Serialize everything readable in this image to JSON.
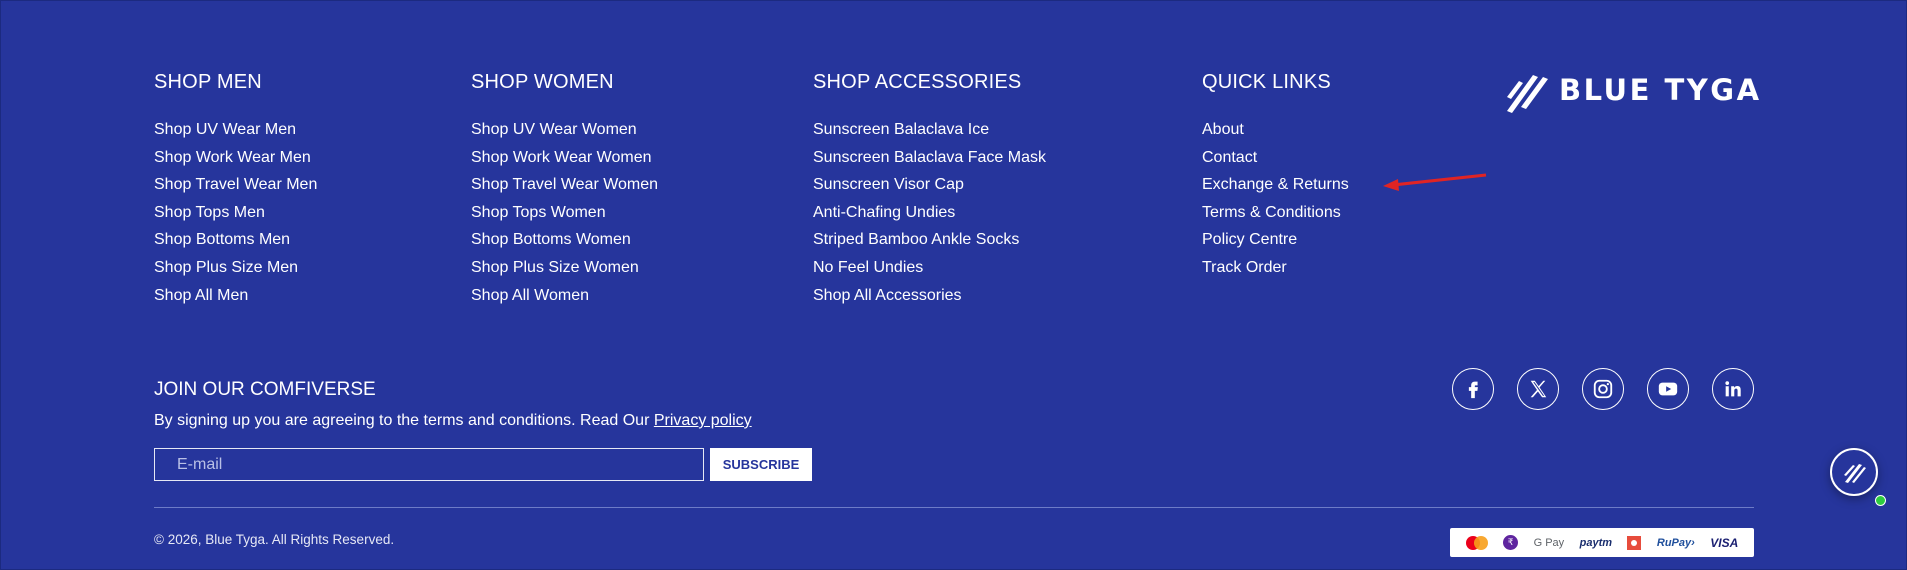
{
  "columns": {
    "men": {
      "title": "SHOP MEN",
      "links": [
        "Shop UV Wear Men",
        "Shop Work Wear Men",
        "Shop Travel Wear Men",
        "Shop Tops Men",
        "Shop Bottoms Men",
        "Shop Plus Size Men",
        "Shop All Men"
      ]
    },
    "women": {
      "title": "SHOP WOMEN",
      "links": [
        "Shop UV Wear Women",
        "Shop Work Wear Women",
        "Shop Travel Wear Women",
        "Shop Tops Women",
        "Shop Bottoms Women",
        "Shop Plus Size Women",
        "Shop All Women"
      ]
    },
    "accessories": {
      "title": "SHOP ACCESSORIES",
      "links": [
        "Sunscreen Balaclava Ice",
        "Sunscreen Balaclava Face Mask",
        "Sunscreen Visor Cap",
        "Anti-Chafing Undies",
        "Striped Bamboo Ankle Socks",
        "No Feel Undies",
        "Shop All Accessories"
      ]
    },
    "quick": {
      "title": "QUICK LINKS",
      "links": [
        "About",
        "Contact",
        "Exchange & Returns",
        "Terms & Conditions",
        "Policy Centre",
        "Track Order"
      ]
    }
  },
  "brand": {
    "name": "BLUE TYGA"
  },
  "newsletter": {
    "title": "JOIN OUR COMFIVERSE",
    "text": "By signing up you are agreeing to the terms and conditions. Read Our ",
    "link": "Privacy policy",
    "placeholder": "E-mail",
    "button": "SUBSCRIBE"
  },
  "social": [
    "facebook-icon",
    "x-icon",
    "instagram-icon",
    "youtube-icon",
    "linkedin-icon"
  ],
  "copyright": "© 2026, Blue Tyga. All Rights Reserved.",
  "payments": {
    "gpay": "G Pay",
    "paytm": "paytm",
    "rupay": "RuPay›",
    "visa": "VISA"
  },
  "colors": {
    "background": "#26359c",
    "annotation_arrow": "#e02424",
    "online_dot": "#2ecc40"
  }
}
